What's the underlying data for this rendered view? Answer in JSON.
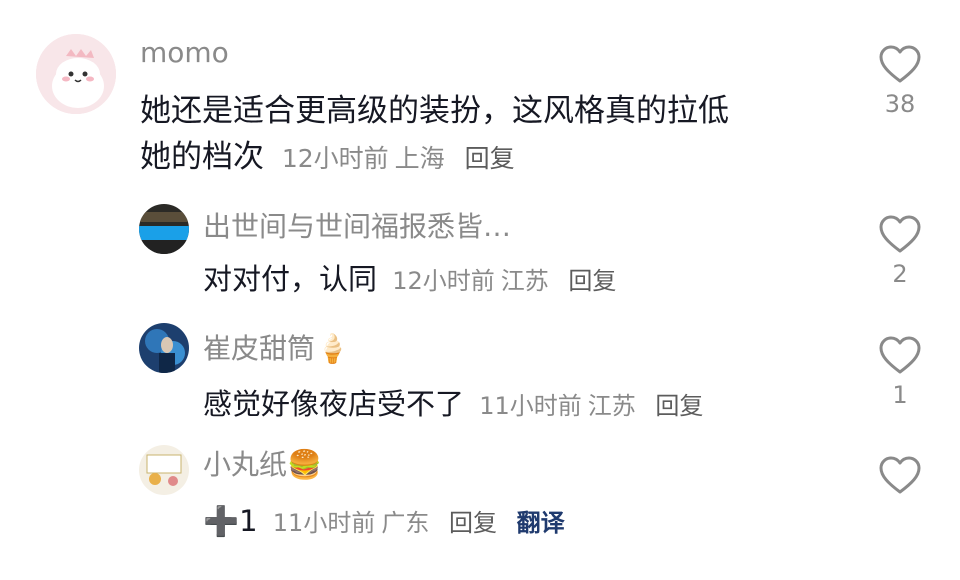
{
  "comments": [
    {
      "username": "momo",
      "text_line1": "她还是适合更高级的装扮，这风格真的拉低",
      "text_line2": "她的档次",
      "time": "12小时前",
      "location": "上海",
      "reply_label": "回复",
      "like_count": "38"
    }
  ],
  "replies": [
    {
      "username": "出世间与世间福报悉皆…",
      "text": "对对付，认同",
      "time": "12小时前",
      "location": "江苏",
      "reply_label": "回复",
      "like_count": "2"
    },
    {
      "username": "崔皮甜筒🍦",
      "text": "感觉好像夜店受不了",
      "time": "11小时前",
      "location": "江苏",
      "reply_label": "回复",
      "like_count": "1"
    },
    {
      "username": "小丸纸🍔",
      "text": "➕1",
      "time": "11小时前",
      "location": "广东",
      "reply_label": "回复",
      "translate_label": "翻译",
      "like_count": ""
    }
  ],
  "colors": {
    "secondary_text": "#8a8a8a",
    "primary_text": "#161823",
    "translate": "#1f3a6e"
  },
  "icons": {
    "like": "heart-outline-icon"
  }
}
